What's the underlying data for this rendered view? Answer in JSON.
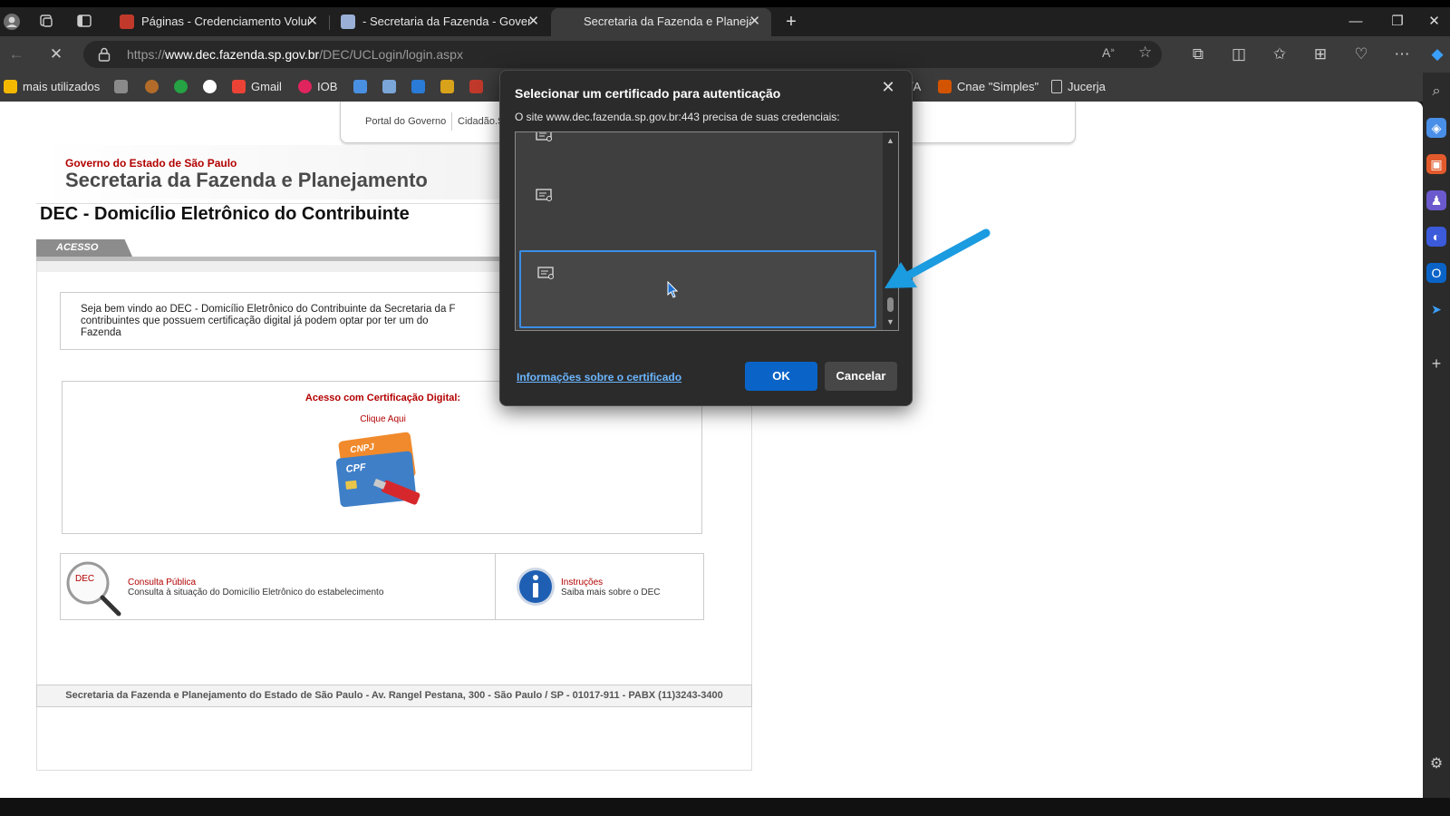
{
  "browser": {
    "tabs": [
      {
        "title": "Páginas - Credenciamento Volun",
        "favicon_color": "#c0392b",
        "active": false
      },
      {
        "title": "- Secretaria da Fazenda - Govern",
        "favicon_color": "#9ab0d6",
        "active": false
      },
      {
        "title": "Secretaria da Fazenda e Planejam",
        "favicon_color": "#3b3b3b",
        "active": true
      }
    ],
    "new_tab_icon": "plus-icon",
    "url_scheme": "https://",
    "url_host": "www.dec.fazenda.sp.gov.br",
    "url_path": "/DEC/UCLogin/login.aspx",
    "bookmarks": [
      {
        "label": "mais utilizados",
        "color": "#f5b800"
      },
      {
        "label": "",
        "color": "#8a8a8a"
      },
      {
        "label": "",
        "color": "#b36b2a"
      },
      {
        "label": "",
        "color": "#25a244"
      },
      {
        "label": "",
        "color": "#ffffff"
      },
      {
        "label": "Gmail",
        "color": "#ea4335"
      },
      {
        "label": "IOB",
        "color": "#e0245e"
      },
      {
        "label": "",
        "color": "#4a90e2"
      },
      {
        "label": "",
        "color": "#7aa6d8"
      },
      {
        "label": "",
        "color": "#2a7bd5"
      },
      {
        "label": "",
        "color": "#d9a21b"
      },
      {
        "label": "",
        "color": "#c0392b"
      },
      {
        "label": "/A",
        "color": ""
      },
      {
        "label": "Cnae \"Simples\"",
        "color": "#d35400"
      },
      {
        "label": "Jucerja",
        "color": ""
      }
    ]
  },
  "page": {
    "gov_links": [
      "Portal do Governo",
      "Cidadão.S"
    ],
    "state_label": "Governo do Estado de São Paulo",
    "secretaria": "Secretaria da Fazenda e Planejamento",
    "dec_title": "DEC - Domicílio Eletrônico do Contribuinte",
    "acesso_tab": "ACESSO",
    "welcome_lines": [
      "Seja bem vindo ao DEC - Domicílio Eletrônico do Contribuinte da Secretaria da F",
      "contribuintes que possuem certificação digital já podem optar por ter um do",
      "Fazenda"
    ],
    "cert_title": "Acesso com Certificação Digital:",
    "cert_click": "Clique Aqui",
    "card_labels": [
      "CNPJ",
      "CPF"
    ],
    "dec_badge": "DEC",
    "consulta_title": "Consulta Pública",
    "consulta_desc": "Consulta à situação do Domicílio Eletrônico do estabelecimento",
    "instrucoes_title": "Instruções",
    "instrucoes_desc": "Saiba mais sobre o DEC",
    "footer": "Secretaria da Fazenda e Planejamento do Estado de São Paulo - Av. Rangel Pestana, 300 - São Paulo / SP - 01017-911 - PABX (11)3243-3400"
  },
  "dialog": {
    "title": "Selecionar um certificado para autenticação",
    "subtitle": "O site www.dec.fazenda.sp.gov.br:443 precisa de suas credenciais:",
    "info_link": "Informações sobre o certificado",
    "ok_label": "OK",
    "cancel_label": "Cancelar"
  },
  "colors": {
    "accent_blue": "#0a64c8",
    "annotation_arrow": "#1b9be0",
    "brand_red": "#b30000"
  }
}
